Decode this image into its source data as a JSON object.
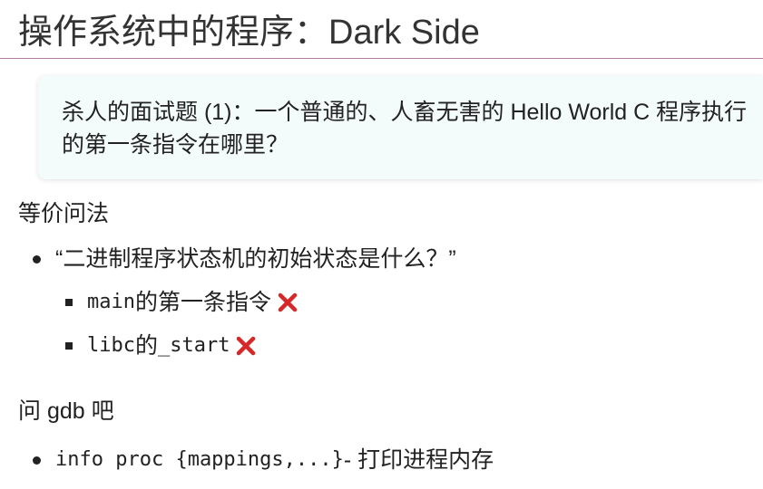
{
  "title": "操作系统中的程序：Dark Side",
  "callout": {
    "text": "杀人的面试题 (1)：一个普通的、人畜无害的 Hello World C 程序执行的第一条指令在哪里？"
  },
  "section1": {
    "heading": "等价问法",
    "question": "“二进制程序状态机的初始状态是什么？”",
    "sub_items": [
      {
        "code": "main",
        "text": " 的第一条指令"
      },
      {
        "code": "libc",
        "text": " 的 ",
        "code2": "_start"
      }
    ]
  },
  "section2": {
    "heading": "问 gdb 吧",
    "item_code": "info proc {mappings,...}",
    "item_text": " - 打印进程内存"
  },
  "colors": {
    "title_rule": "#b07aa1",
    "callout_bg": "#f4fbfb",
    "cross": "#d62828"
  },
  "icons": {
    "wrong": "cross-mark-icon"
  }
}
